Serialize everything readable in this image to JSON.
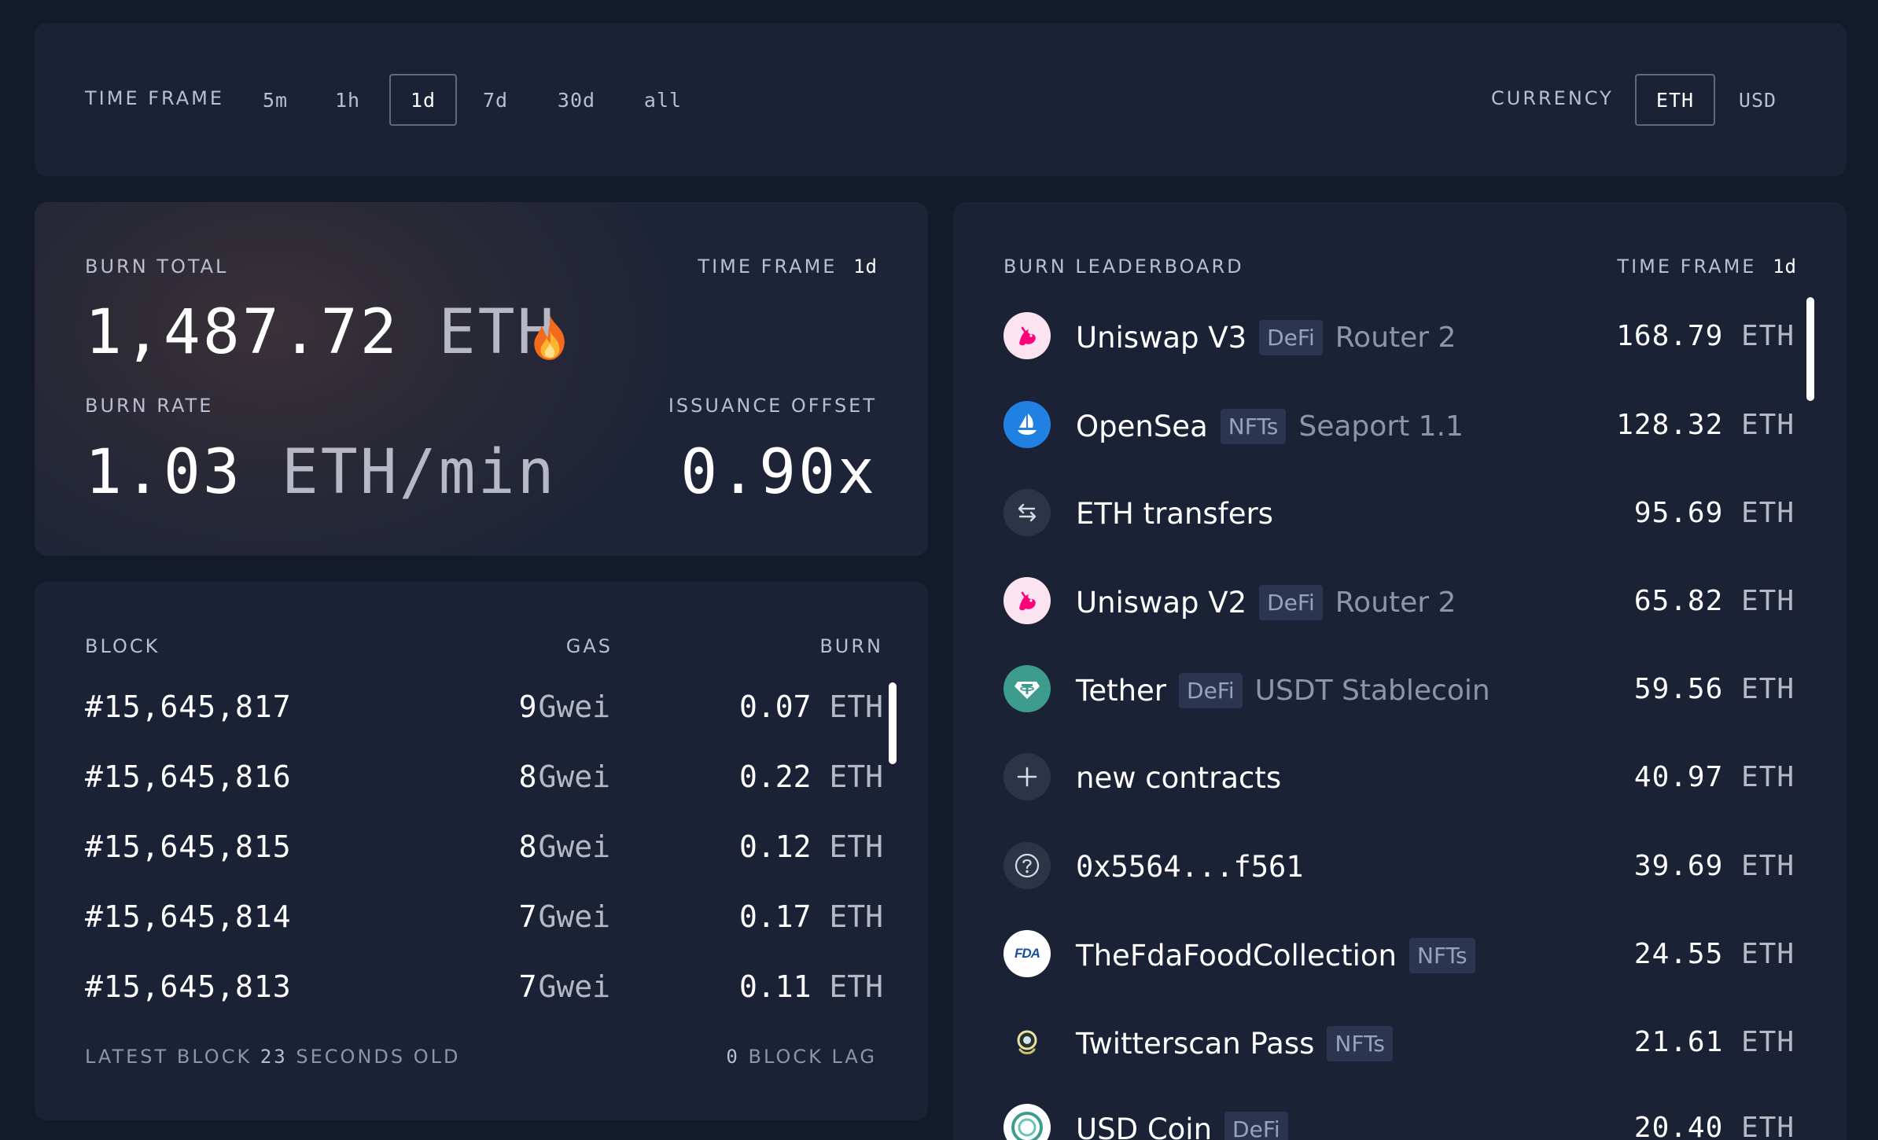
{
  "timeframe": {
    "label": "TIME FRAME",
    "options": [
      "5m",
      "1h",
      "1d",
      "7d",
      "30d",
      "all"
    ],
    "selected": "1d"
  },
  "currency": {
    "label": "CURRENCY",
    "options": [
      "ETH",
      "USD"
    ],
    "selected": "ETH"
  },
  "burn_total": {
    "label": "BURN TOTAL",
    "timeframe_label": "TIME FRAME",
    "timeframe_value": "1d",
    "value": "1,487.72",
    "unit": "ETH",
    "icon": "fire-icon",
    "burn_rate_label": "BURN RATE",
    "burn_rate_value": "1.03",
    "burn_rate_unit": "ETH/min",
    "issuance_offset_label": "ISSUANCE OFFSET",
    "issuance_offset_value": "0.90x"
  },
  "blocks": {
    "headers": {
      "block": "BLOCK",
      "gas": "GAS",
      "burn": "BURN"
    },
    "rows": [
      {
        "number": "#15,645,817",
        "gas": "9",
        "gas_unit": "Gwei",
        "burn": "0.07",
        "burn_unit": "ETH"
      },
      {
        "number": "#15,645,816",
        "gas": "8",
        "gas_unit": "Gwei",
        "burn": "0.22",
        "burn_unit": "ETH"
      },
      {
        "number": "#15,645,815",
        "gas": "8",
        "gas_unit": "Gwei",
        "burn": "0.12",
        "burn_unit": "ETH"
      },
      {
        "number": "#15,645,814",
        "gas": "7",
        "gas_unit": "Gwei",
        "burn": "0.17",
        "burn_unit": "ETH"
      },
      {
        "number": "#15,645,813",
        "gas": "7",
        "gas_unit": "Gwei",
        "burn": "0.11",
        "burn_unit": "ETH"
      }
    ],
    "latest_prefix": "LATEST BLOCK",
    "latest_seconds": "23",
    "latest_suffix": "SECONDS OLD",
    "lag_value": "0",
    "lag_label": "BLOCK LAG"
  },
  "leaderboard": {
    "label": "BURN LEADERBOARD",
    "timeframe_label": "TIME FRAME",
    "timeframe_value": "1d",
    "rows": [
      {
        "name": "Uniswap V3",
        "badge": "DeFi",
        "detail": "Router 2",
        "value": "168.79",
        "unit": "ETH",
        "icon": "uniswap-icon"
      },
      {
        "name": "OpenSea",
        "badge": "NFTs",
        "detail": "Seaport 1.1",
        "value": "128.32",
        "unit": "ETH",
        "icon": "opensea-icon"
      },
      {
        "name": "ETH transfers",
        "badge": "",
        "detail": "",
        "value": "95.69",
        "unit": "ETH",
        "icon": "transfer-arrows-icon"
      },
      {
        "name": "Uniswap V2",
        "badge": "DeFi",
        "detail": "Router 2",
        "value": "65.82",
        "unit": "ETH",
        "icon": "uniswap-icon"
      },
      {
        "name": "Tether",
        "badge": "DeFi",
        "detail": "USDT Stablecoin",
        "value": "59.56",
        "unit": "ETH",
        "icon": "tether-icon"
      },
      {
        "name": "new contracts",
        "badge": "",
        "detail": "",
        "value": "40.97",
        "unit": "ETH",
        "icon": "plus-icon"
      },
      {
        "name": "0x5564...f561",
        "badge": "",
        "detail": "",
        "value": "39.69",
        "unit": "ETH",
        "icon": "question-icon"
      },
      {
        "name": "TheFdaFoodCollection",
        "badge": "NFTs",
        "detail": "",
        "value": "24.55",
        "unit": "ETH",
        "icon": "fda-icon",
        "icon_text": "FDA"
      },
      {
        "name": "Twitterscan Pass",
        "badge": "NFTs",
        "detail": "",
        "value": "21.61",
        "unit": "ETH",
        "icon": "twitterscan-icon"
      },
      {
        "name": "USD Coin",
        "badge": "DeFi",
        "detail": "",
        "value": "20.40",
        "unit": "ETH",
        "icon": "usdc-icon"
      }
    ]
  },
  "colors": {
    "background": "#131a2a",
    "card": "#1b2236",
    "badge": "#2c3550",
    "muted_text": "#b9bfd0",
    "active_border": "#5b6a85"
  }
}
